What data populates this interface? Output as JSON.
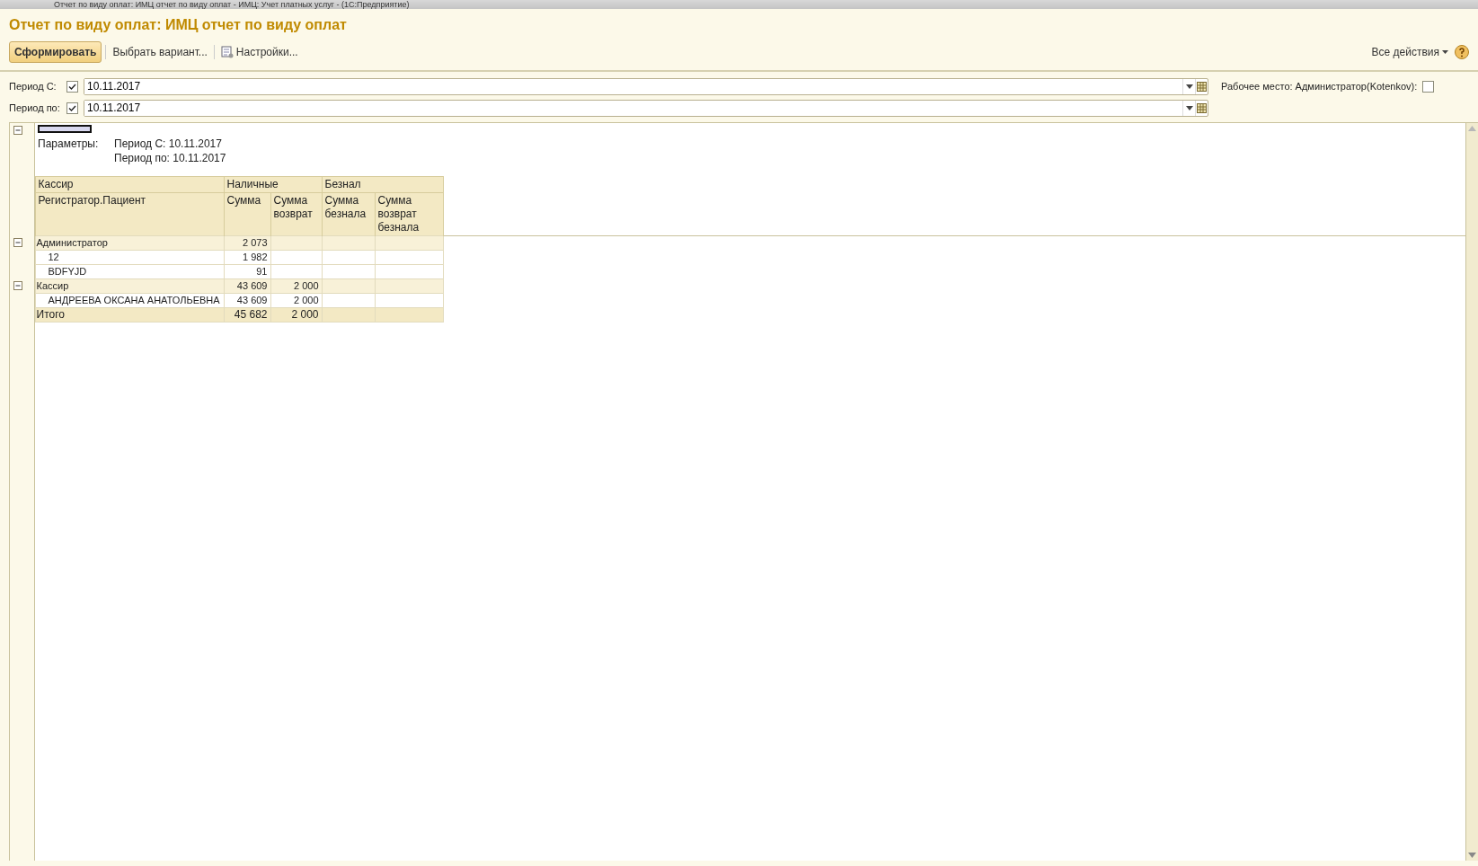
{
  "window": {
    "title": "Отчет по виду оплат: ИМЦ отчет по виду оплат - ИМЦ: Учет платных услуг - (1С:Предприятие)"
  },
  "heading": "Отчет по виду оплат: ИМЦ отчет по виду оплат",
  "toolbar": [
    {
      "label": "Сформировать",
      "kind": "primary"
    },
    {
      "label": "Выбрать вариант...",
      "kind": "plain"
    },
    {
      "label": "Настройки...",
      "kind": "settings"
    }
  ],
  "all_actions": "Все действия",
  "filters": [
    {
      "label": "Период С:",
      "checked": true,
      "value": "10.11.2017"
    },
    {
      "label": "Период по:",
      "checked": true,
      "value": "10.11.2017"
    }
  ],
  "workplace": {
    "label": "Рабочее место: Администратор(Kotenkov):",
    "checked": false
  },
  "report": {
    "params_label": "Параметры:",
    "params": [
      "Период С: 10.11.2017",
      "Период по: 10.11.2017"
    ],
    "header_top": [
      "Кассир",
      "Наличные",
      "Безнал"
    ],
    "header_bottom": [
      "Регистратор.Пациент",
      "Сумма",
      "Сумма возврат",
      "Сумма безнала",
      "Сумма возврат безнала"
    ],
    "groups": [
      {
        "name": "Администратор",
        "expanded": true,
        "values": [
          "2 073"
        ],
        "children": [
          {
            "name": "12",
            "values": [
              "1 982"
            ]
          },
          {
            "name": "BDFYJD",
            "values": [
              "91"
            ]
          }
        ]
      },
      {
        "name": "Кассир",
        "expanded": true,
        "values": [
          "43 609",
          "2 000"
        ],
        "children": [
          {
            "name": "АНДРЕЕВА ОКСАНА АНАТОЛЬЕВНА",
            "values": [
              "43 609",
              "2 000"
            ]
          }
        ]
      }
    ],
    "total": {
      "label": "Итого",
      "values": [
        "45 682",
        "2 000"
      ]
    }
  }
}
